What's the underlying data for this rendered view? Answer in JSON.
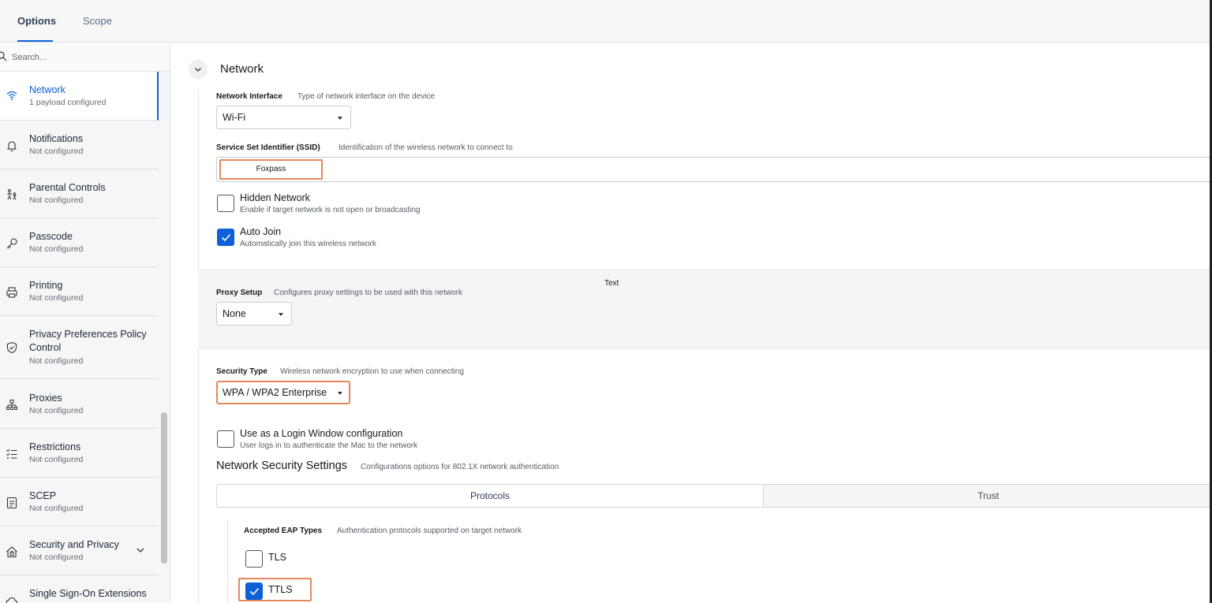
{
  "tabs": [
    {
      "label": "Options",
      "active": true
    },
    {
      "label": "Scope",
      "active": false
    }
  ],
  "sidebar": {
    "search_placeholder": "Search...",
    "items": [
      {
        "title": "Network",
        "subtitle": "1 payload configured",
        "icon": "wifi-icon",
        "active": true
      },
      {
        "title": "Notifications",
        "subtitle": "Not configured",
        "icon": "bell-icon"
      },
      {
        "title": "Parental Controls",
        "subtitle": "Not configured",
        "icon": "family-icon"
      },
      {
        "title": "Passcode",
        "subtitle": "Not configured",
        "icon": "key-icon"
      },
      {
        "title": "Printing",
        "subtitle": "Not configured",
        "icon": "printer-icon"
      },
      {
        "title": "Privacy Preferences Policy Control",
        "subtitle": "Not configured",
        "icon": "shield-icon"
      },
      {
        "title": "Proxies",
        "subtitle": "Not configured",
        "icon": "network-tree-icon"
      },
      {
        "title": "Restrictions",
        "subtitle": "Not configured",
        "icon": "checklist-icon"
      },
      {
        "title": "SCEP",
        "subtitle": "Not configured",
        "icon": "certificate-icon"
      },
      {
        "title": "Security and Privacy",
        "subtitle": "Not configured",
        "icon": "house-lock-icon",
        "expandable": true
      },
      {
        "title": "Single Sign-On Extensions",
        "subtitle": "",
        "icon": "cloud-icon"
      }
    ]
  },
  "section": {
    "title": "Network"
  },
  "network_interface": {
    "label": "Network Interface",
    "description": "Type of network interface on the device",
    "value": "Wi-Fi"
  },
  "ssid": {
    "label": "Service Set Identifier (SSID)",
    "description": "Identification of the wireless network to connect to",
    "value": "Foxpass"
  },
  "hidden_network": {
    "label": "Hidden Network",
    "description": "Enable if target network is not open or broadcasting",
    "checked": false
  },
  "auto_join": {
    "label": "Auto Join",
    "description": "Automatically join this wireless network",
    "checked": true
  },
  "stray_text": "Text",
  "proxy": {
    "label": "Proxy Setup",
    "description": "Configures proxy settings to be used with this network",
    "value": "None"
  },
  "security_type": {
    "label": "Security Type",
    "description": "Wireless network encryption to use when connecting",
    "value": "WPA / WPA2 Enterprise"
  },
  "login_window": {
    "label": "Use as a Login Window configuration",
    "description": "User logs in to authenticate the Mac to the network",
    "checked": false
  },
  "network_security": {
    "title": "Network Security Settings",
    "description": "Configurations options for 802.1X network authentication",
    "tabs": [
      {
        "label": "Protocols",
        "active": true
      },
      {
        "label": "Trust",
        "active": false
      }
    ]
  },
  "eap": {
    "label": "Accepted EAP Types",
    "description": "Authentication protocols supported on target network",
    "types": [
      {
        "label": "TLS",
        "checked": false
      },
      {
        "label": "TTLS",
        "checked": true
      }
    ]
  },
  "colors": {
    "accent": "#0d60d8",
    "highlight": "#e8865c"
  }
}
